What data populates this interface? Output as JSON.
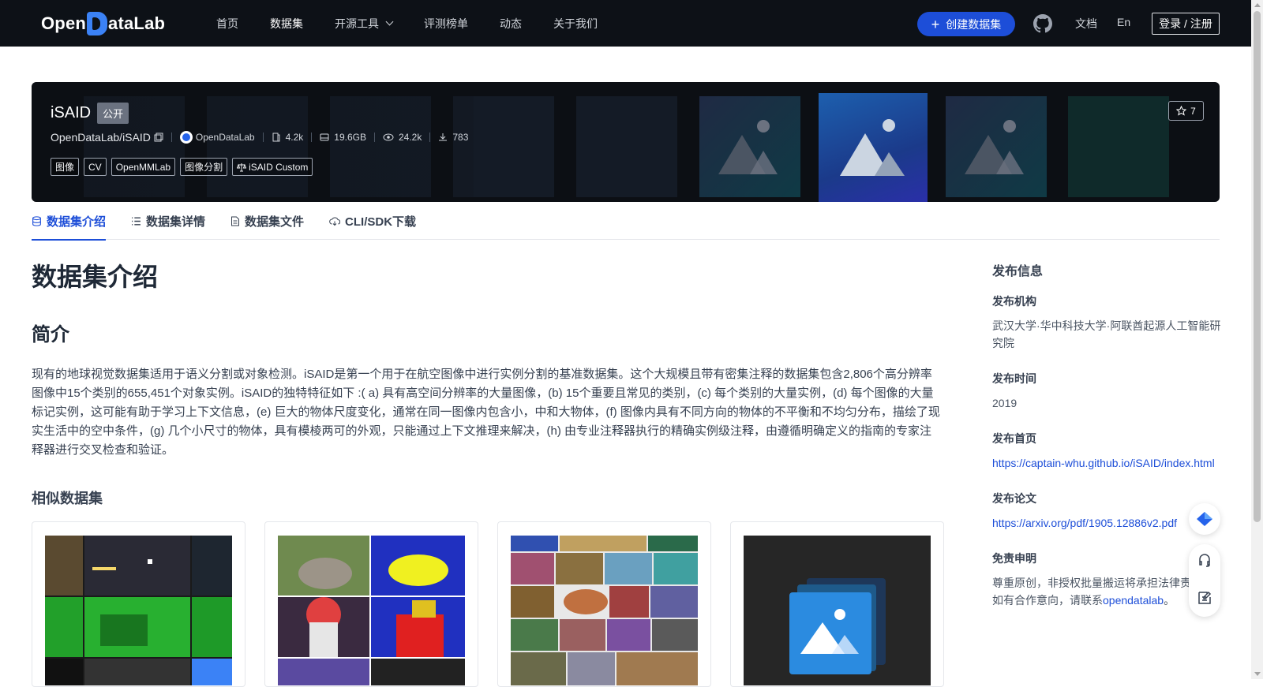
{
  "header": {
    "logo_text_left": "Open",
    "logo_text_right": "ataLab",
    "nav": [
      "首页",
      "数据集",
      "开源工具",
      "评测榜单",
      "动态",
      "关于我们"
    ],
    "active_nav": "数据集",
    "create_button": "创建数据集",
    "docs": "文档",
    "lang": "En",
    "login": "登录 / 注册"
  },
  "dataset": {
    "name": "iSAID",
    "visibility": "公开",
    "path": "OpenDataLab/iSAID",
    "org": "OpenDataLab",
    "stats": {
      "likes_views": "4.2k",
      "size": "19.6GB",
      "views": "24.2k",
      "downloads": "783"
    },
    "tags": [
      "图像",
      "CV",
      "OpenMMLab",
      "图像分割"
    ],
    "license": "iSAID Custom",
    "stars": "7"
  },
  "tabs": [
    "数据集介绍",
    "数据集详情",
    "数据集文件",
    "CLI/SDK下载"
  ],
  "active_tab": "数据集介绍",
  "content": {
    "title": "数据集介绍",
    "section": "简介",
    "intro": "现有的地球视觉数据集适用于语义分割或对象检测。iSAID是第一个用于在航空图像中进行实例分割的基准数据集。这个大规模且带有密集注释的数据集包含2,806个高分辨率图像中15个类别的655,451个对象实例。iSAID的独特特征如下 :( a) 具有高空间分辨率的大量图像，(b) 15个重要且常见的类别，(c) 每个类别的大量实例，(d) 每个图像的大量标记实例，这可能有助于学习上下文信息，(e) 巨大的物体尺度变化，通常在同一图像内包含小，中和大物体，(f) 图像内具有不同方向的物体的不平衡和不均匀分布，描绘了现实生活中的空中条件，(g) 几个小尺寸的物体，具有模棱两可的外观，只能通过上下文推理来解决，(h) 由专业注释器执行的精确实例级注释，由遵循明确定义的指南的专家注释器进行交叉检查和验证。",
    "similar_title": "相似数据集"
  },
  "sidebar": {
    "title": "发布信息",
    "publisher_label": "发布机构",
    "publisher": "武汉大学·华中科技大学·阿联酋起源人工智能研究院",
    "time_label": "发布时间",
    "time": "2019",
    "homepage_label": "发布首页",
    "homepage": "https://captain-whu.github.io/iSAID/index.html",
    "paper_label": "发布论文",
    "paper": "https://arxiv.org/pdf/1905.12886v2.pdf",
    "disclaimer_label": "免责申明",
    "disclaimer_text": "尊重原创，非授权批量搬运将承担法律责任，如有合作意向，请联系",
    "disclaimer_link": "opendatalab",
    "disclaimer_end": "。"
  },
  "icons": {
    "github": "github-icon",
    "star": "star-icon",
    "copy": "copy-icon"
  },
  "colors": {
    "header_bg": "#0d1117",
    "accent": "#1d4ed8",
    "banner_bg": "#0c0f14"
  }
}
